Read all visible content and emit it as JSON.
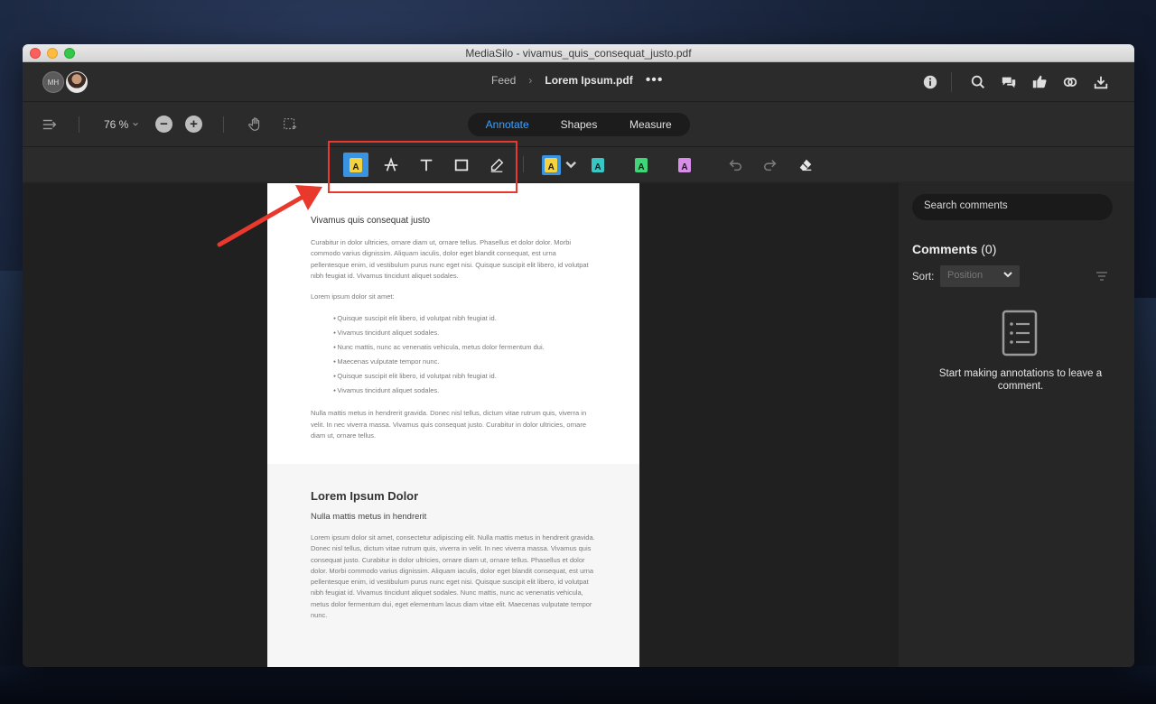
{
  "window": {
    "title": "MediaSilo - vivamus_quis_consequat_justo.pdf"
  },
  "header": {
    "avatar_initials": "MH",
    "breadcrumb_feed": "Feed",
    "breadcrumb_file": "Lorem Ipsum.pdf",
    "more_label": "•••",
    "icons": [
      "info-icon",
      "search-icon",
      "comments-icon",
      "thumbs-up-icon",
      "link-icon",
      "download-icon"
    ]
  },
  "toolbar": {
    "zoom": "76 %",
    "zoom_out": "−",
    "zoom_in": "+",
    "modes": [
      {
        "label": "Annotate",
        "active": true
      },
      {
        "label": "Shapes",
        "active": false
      },
      {
        "label": "Measure",
        "active": false
      }
    ]
  },
  "annotation_tools": {
    "highlight_letter": "A",
    "highlight_colors": [
      "#f5d33f",
      "#38c7c4",
      "#3fd67a",
      "#d88ee8"
    ],
    "selected_color": "#3a93e0"
  },
  "document": {
    "page1": {
      "title": "Vivamus quis consequat justo",
      "para1": "Curabitur in dolor ultricies, ornare diam ut, ornare tellus. Phasellus et dolor dolor. Morbi commodo varius dignissim. Aliquam iaculis, dolor eget blandit consequat, est urna pellentesque enim, id vestibulum purus nunc eget nisi. Quisque suscipit elit libero, id volutpat nibh feugiat id. Vivamus tincidunt aliquet sodales.",
      "list_intro": "Lorem ipsum dolor sit amet:",
      "list": [
        "Quisque suscipit elit libero, id volutpat nibh feugiat id.",
        "Vivamus tincidunt aliquet sodales.",
        "Nunc mattis, nunc ac venenatis vehicula, metus dolor fermentum dui.",
        "Maecenas vulputate tempor nunc.",
        "Quisque suscipit elit libero, id volutpat nibh feugiat id.",
        "Vivamus tincidunt aliquet sodales."
      ],
      "para2": "Nulla mattis metus in hendrerit gravida. Donec nisl tellus, dictum vitae rutrum quis, viverra in velit. In nec viverra massa. Vivamus quis consequat justo. Curabitur in dolor ultricies, ornare diam ut, ornare tellus."
    },
    "page2": {
      "heading": "Lorem Ipsum Dolor",
      "subheading": "Nulla mattis metus in hendrerit",
      "body": "Lorem ipsum dolor sit amet, consectetur adipiscing elit. Nulla mattis metus in hendrerit gravida. Donec nisl tellus, dictum vitae rutrum quis, viverra in velit. In nec viverra massa. Vivamus quis consequat justo. Curabitur in dolor ultricies, ornare diam ut, ornare tellus. Phasellus et dolor dolor. Morbi commodo varius dignissim. Aliquam iaculis, dolor eget blandit consequat, est urna pellentesque enim, id vestibulum purus nunc eget nisi. Quisque suscipit elit libero, id volutpat nibh feugiat id. Vivamus tincidunt aliquet sodales. Nunc mattis, nunc ac venenatis vehicula, metus dolor fermentum dui, eget elementum lacus diam vitae elit. Maecenas vulputate tempor nunc."
    }
  },
  "sidebar": {
    "search_placeholder": "Search comments",
    "comments_label": "Comments",
    "comments_count": "(0)",
    "sort_label": "Sort:",
    "sort_value": "Position",
    "empty_text": "Start making annotations to leave a comment."
  },
  "annotation_overlay_color": "#e8392c"
}
